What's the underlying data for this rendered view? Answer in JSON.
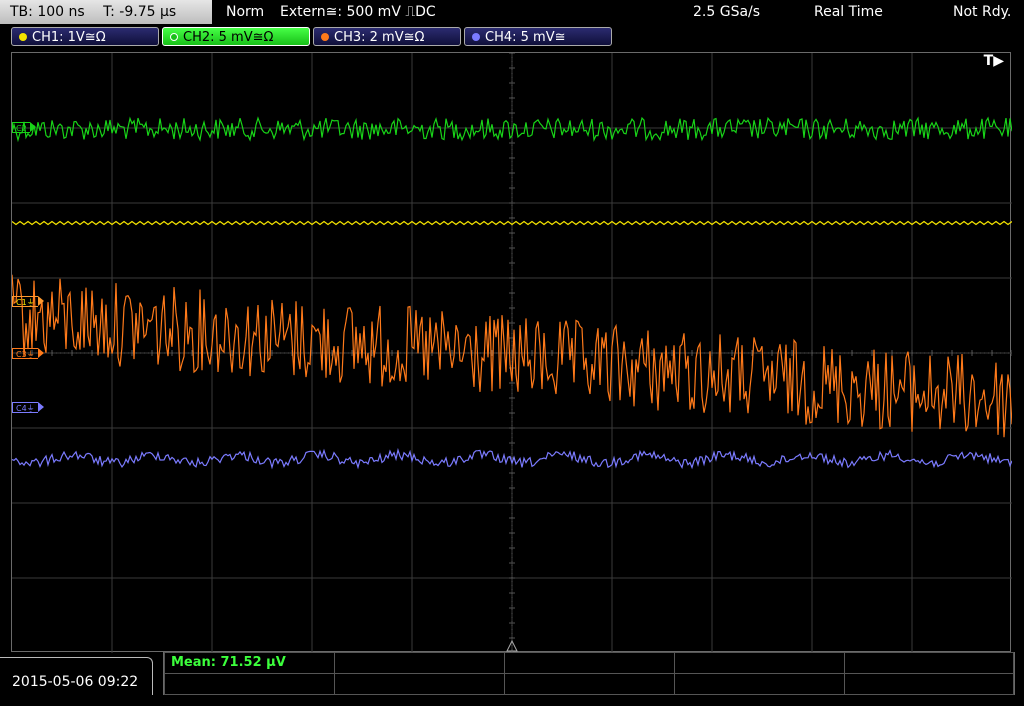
{
  "topbar": {
    "timebase": "TB: 100 ns",
    "trigger_time": "T: -9.75 µs",
    "mode": "Norm",
    "trigger_source": "Extern≅: 500 mV ⎍DC",
    "sample_rate": "2.5 GSa/s",
    "acq_mode": "Real Time",
    "status": "Not Rdy."
  },
  "channels": [
    {
      "label": "CH1: 1V≅Ω",
      "color": "#f5e400"
    },
    {
      "label": "CH2: 5 mV≅Ω",
      "color": "#18d418"
    },
    {
      "label": "CH3: 2 mV≅Ω",
      "color": "#ff7a1a"
    },
    {
      "label": "CH4: 5 mV≅",
      "color": "#7b7bff"
    }
  ],
  "markers": {
    "c1": "C1⏚",
    "c2": "C2",
    "c3": "C3⏚",
    "c4": "C4⏚"
  },
  "trigger_indicator": "T▶",
  "bottom": {
    "datetime": "2015-05-06 09:22",
    "measurement": "Mean: 71.52 µV"
  }
}
